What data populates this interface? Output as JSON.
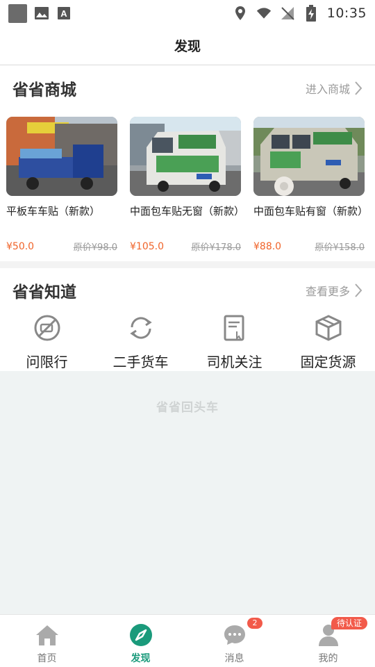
{
  "status_bar": {
    "time": "10:35"
  },
  "header": {
    "title": "发现"
  },
  "mall": {
    "title": "省省商城",
    "more_label": "进入商城",
    "products": [
      {
        "name": "平板车车贴（新款）",
        "price": "¥50.0",
        "original_price": "原价¥98.0"
      },
      {
        "name": "中面包车贴无窗（新款）",
        "price": "¥105.0",
        "original_price": "原价¥178.0"
      },
      {
        "name": "中面包车贴有窗（新款）",
        "price": "¥88.0",
        "original_price": "原价¥158.0"
      }
    ]
  },
  "knowledge": {
    "title": "省省知道",
    "more_label": "查看更多",
    "features": [
      {
        "label": "问限行",
        "icon": "no-driving-icon"
      },
      {
        "label": "二手货车",
        "icon": "refresh-icon"
      },
      {
        "label": "司机关注",
        "icon": "document-tap-icon"
      },
      {
        "label": "固定货源",
        "icon": "box-icon"
      }
    ]
  },
  "banner": {
    "logo_text": "省省回头车"
  },
  "bottom_nav": {
    "items": [
      {
        "label": "首页",
        "icon": "home-icon",
        "active": false
      },
      {
        "label": "发现",
        "icon": "compass-icon",
        "active": true
      },
      {
        "label": "消息",
        "icon": "chat-icon",
        "active": false,
        "badge": "2"
      },
      {
        "label": "我的",
        "icon": "user-icon",
        "active": false,
        "badge": "待认证"
      }
    ]
  },
  "colors": {
    "accent": "#1a9a7b",
    "price": "#f0642a",
    "badge": "#f25a4a"
  }
}
